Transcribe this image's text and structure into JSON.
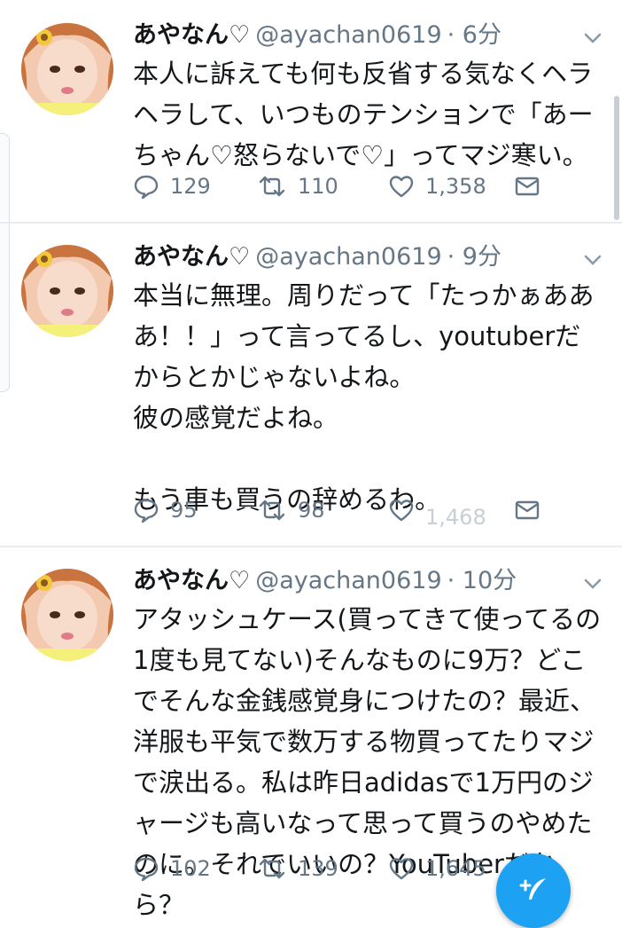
{
  "tweets": [
    {
      "display_name": "あやなん♡",
      "handle": "@ayachan0619",
      "time": "· 6分",
      "text": "本人に訴えても何も反省する気なくヘラヘラして、いつものテンションで「あーちゃん♡怒らないで♡」ってマジ寒い。",
      "replies": "129",
      "retweets": "110",
      "likes": "1,358"
    },
    {
      "display_name": "あやなん♡",
      "handle": "@ayachan0619",
      "time": "· 9分",
      "text": "本当に無理。周りだって「たっかぁあああ！！」って言ってるし、youtuberだからとかじゃないよね。\n彼の感覚だよね。\n\nもう車も買うの辞めるわ。",
      "replies": "95",
      "retweets": "98",
      "likes": "1,468"
    },
    {
      "display_name": "あやなん♡",
      "handle": "@ayachan0619",
      "time": "· 10分",
      "text": "アタッシュケース(買ってきて使ってるの1度も見てない)そんなものに9万？どこでそんな金銭感覚身につけたの？最近、洋服も平気で数万する物買ってたりマジで涙出る。私は昨日adidasで1万円のジャージも高いなって思って買うのやめたのに。それでいいの？YouTuberだから？",
      "replies": "102",
      "retweets": "139",
      "likes": "1,645"
    }
  ],
  "icons": {
    "reply": "speech-bubble-icon",
    "retweet": "retweet-arrows-icon",
    "like": "heart-icon",
    "dm": "envelope-icon",
    "caret": "chevron-down-icon",
    "compose": "feather-plus-icon"
  },
  "colors": {
    "accent": "#1da1f2",
    "text": "#14171a",
    "muted": "#657786",
    "divider": "#e6ecf0"
  }
}
